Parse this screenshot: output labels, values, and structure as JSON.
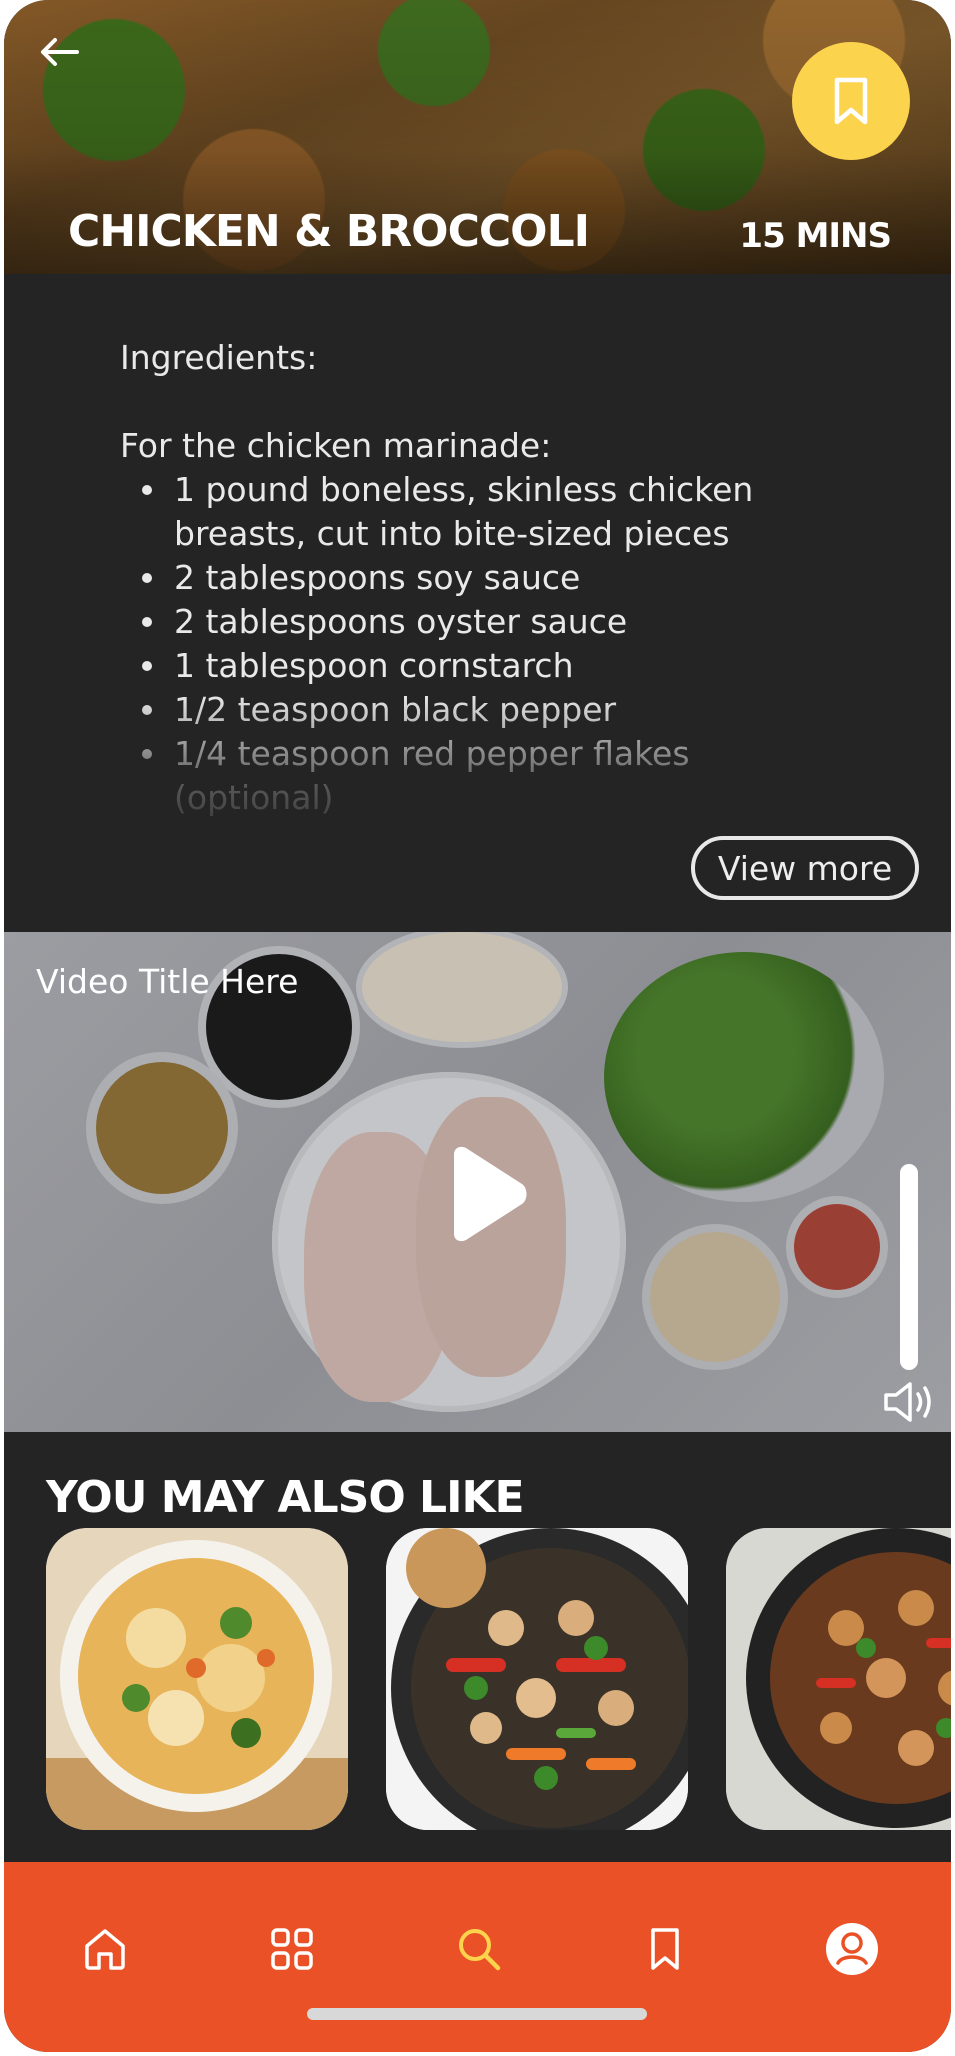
{
  "recipe": {
    "title": "CHICKEN & BROCCOLI",
    "time": "15 MINS"
  },
  "ingredients": {
    "heading": "Ingredients:",
    "subheading": "For the chicken marinade:",
    "items": [
      "1 pound boneless, skinless chicken breasts, cut into bite-sized pieces",
      "2 tablespoons soy sauce",
      "2 tablespoons oyster sauce",
      "1 tablespoon cornstarch",
      "1/2 teaspoon black pepper",
      "1/4 teaspoon red pepper flakes (optional)"
    ],
    "view_more_label": "View more"
  },
  "video": {
    "title": "Video Title Here",
    "volume_level": 1.0
  },
  "suggestions": {
    "title": "YOU MAY ALSO LIKE"
  },
  "nav": {
    "items": [
      "home-icon",
      "grid-icon",
      "search-icon",
      "bookmark-icon",
      "profile-icon"
    ],
    "active": "search-icon"
  },
  "colors": {
    "accent_yellow": "#fcd34d",
    "nav_orange": "#ea5126",
    "panel_dark": "#242424"
  }
}
